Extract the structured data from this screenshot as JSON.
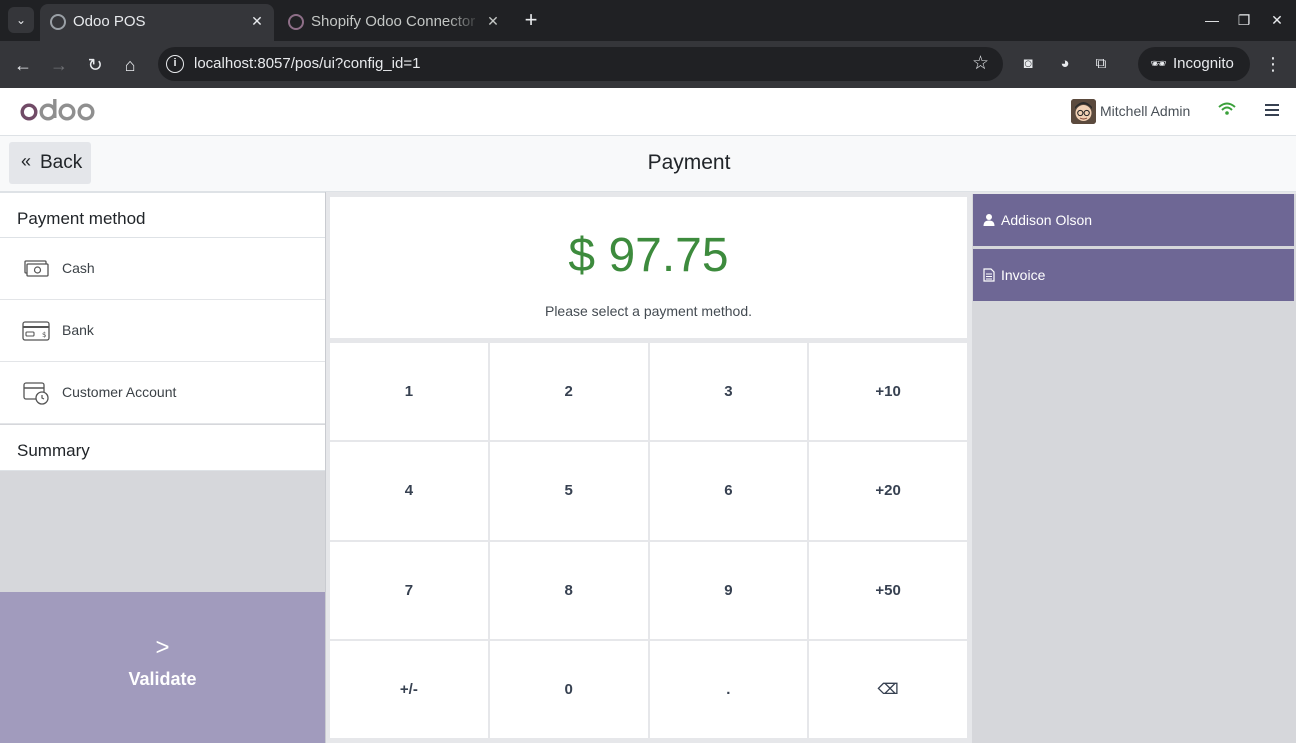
{
  "browser": {
    "tabs": [
      {
        "title": "Odoo POS",
        "close": "✕"
      },
      {
        "title": "Shopify Odoo Connector",
        "close": "✕"
      }
    ],
    "new_tab": "+",
    "url": "localhost:8057/pos/ui?config_id=1",
    "profile_label": "Incognito"
  },
  "header": {
    "logo": "odoo",
    "user_name": "Mitchell Admin"
  },
  "titlebar": {
    "back_label": "Back",
    "title": "Payment"
  },
  "payment_methods": {
    "heading": "Payment method",
    "items": [
      {
        "label": "Cash",
        "icon": "cash-icon"
      },
      {
        "label": "Bank",
        "icon": "bank-card-icon"
      },
      {
        "label": "Customer Account",
        "icon": "customer-account-icon"
      }
    ],
    "summary_heading": "Summary"
  },
  "payment": {
    "amount": "$ 97.75",
    "hint": "Please select a payment method."
  },
  "numpad": {
    "keys": [
      "1",
      "2",
      "3",
      "+10",
      "4",
      "5",
      "6",
      "+20",
      "7",
      "8",
      "9",
      "+50",
      "+/-",
      "0",
      ".",
      "⌫"
    ]
  },
  "validate": {
    "label": "Validate"
  },
  "side_actions": {
    "customer": "Addison Olson",
    "invoice": "Invoice"
  },
  "colors": {
    "accent": "#6e6795",
    "validate": "#a19bbd",
    "amount": "#3d8b3d"
  }
}
